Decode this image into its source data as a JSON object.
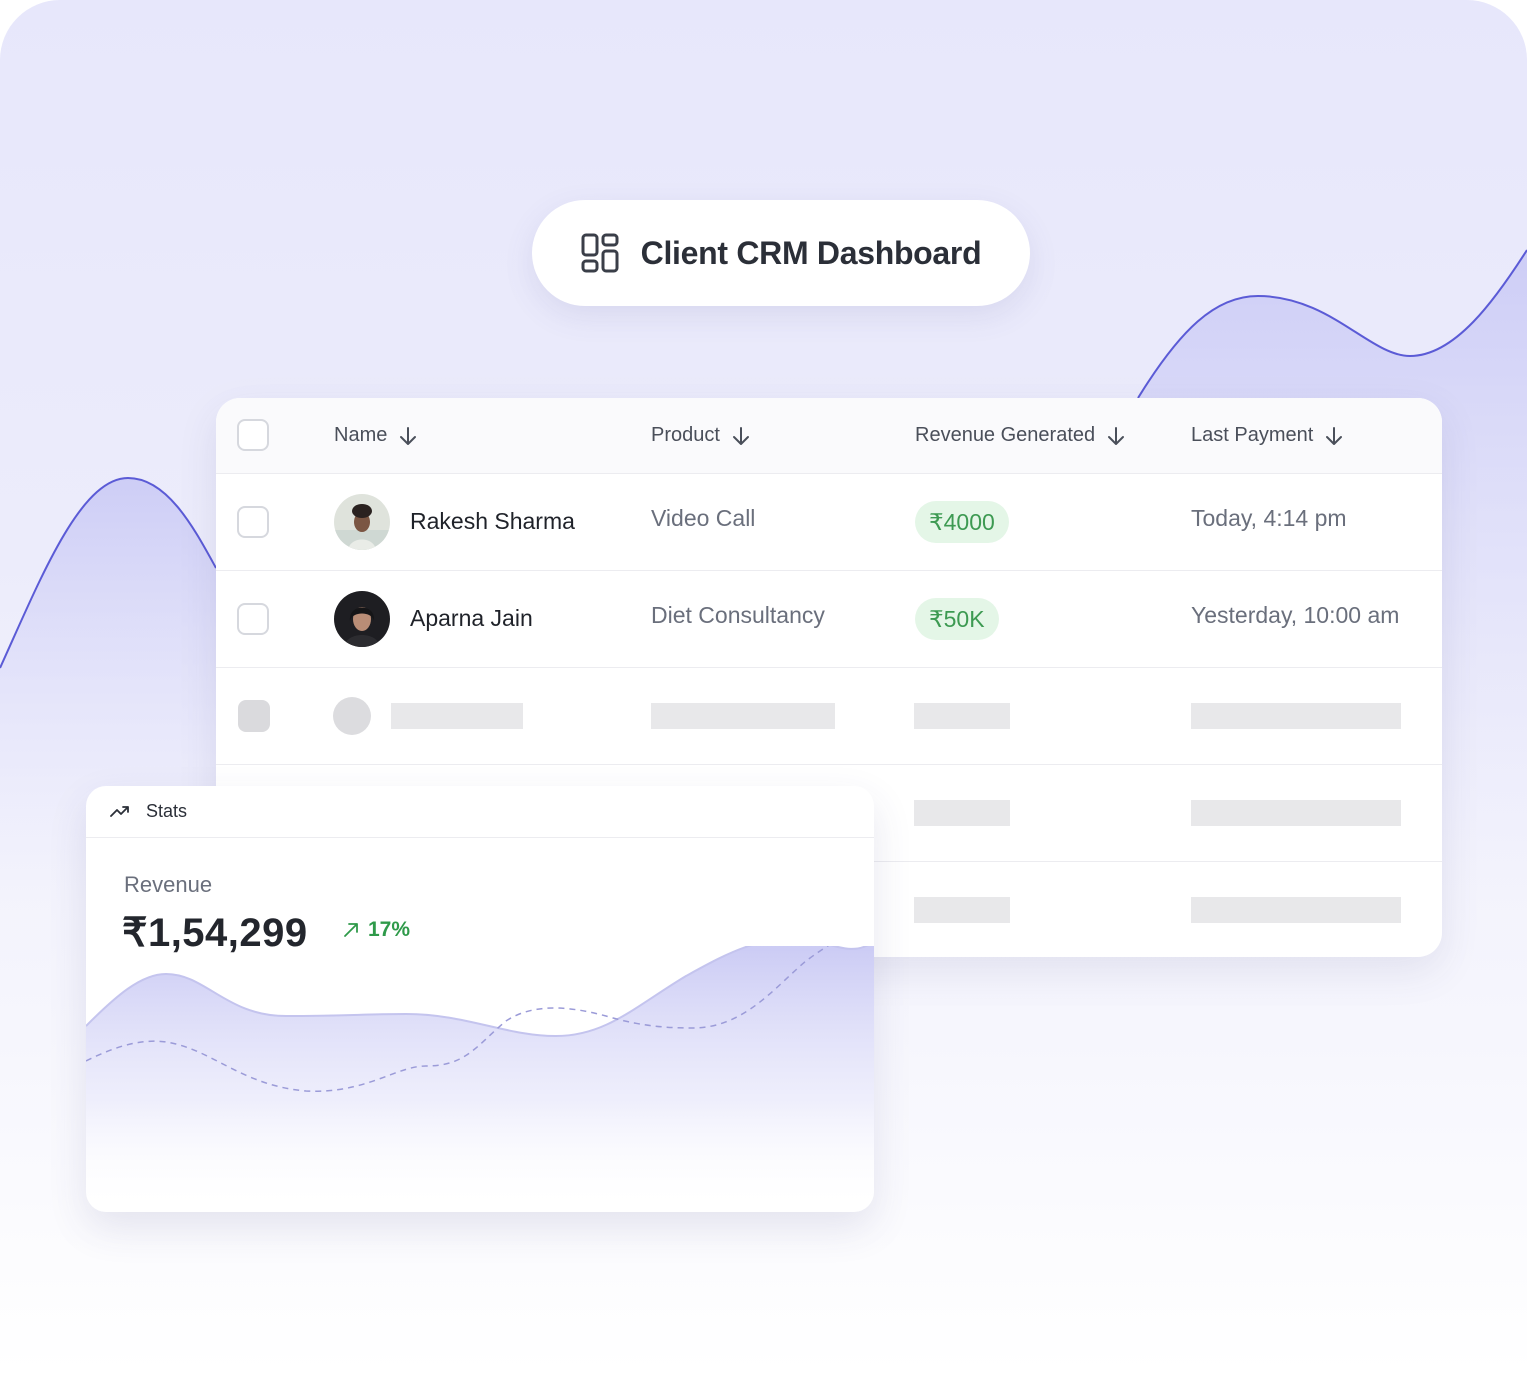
{
  "header": {
    "title": "Client CRM Dashboard",
    "icon": "grid-layout-icon"
  },
  "colors": {
    "accent": "#5b5bd6",
    "accent_fill": "#d3d3f8",
    "positive": "#2f9a4a",
    "positive_bg": "#e4f6e7"
  },
  "table": {
    "columns": [
      {
        "label": "Name",
        "sort_icon": "arrow-down-icon"
      },
      {
        "label": "Product",
        "sort_icon": "arrow-down-icon"
      },
      {
        "label": "Revenue Generated",
        "sort_icon": "arrow-down-icon"
      },
      {
        "label": "Last Payment",
        "sort_icon": "arrow-down-icon"
      }
    ],
    "rows": [
      {
        "name": "Rakesh Sharma",
        "product": "Video Call",
        "revenue": "₹4000",
        "last_payment": "Today, 4:14 pm"
      },
      {
        "name": "Aparna Jain",
        "product": "Diet Consultancy",
        "revenue": "₹50K",
        "last_payment": "Yesterday, 10:00 am"
      }
    ],
    "placeholder_rows": 3
  },
  "stats": {
    "title": "Stats",
    "icon": "trend-up-icon",
    "revenue_label": "Revenue",
    "revenue_value": "₹1,54,299",
    "change": "17%",
    "change_direction": "up"
  }
}
